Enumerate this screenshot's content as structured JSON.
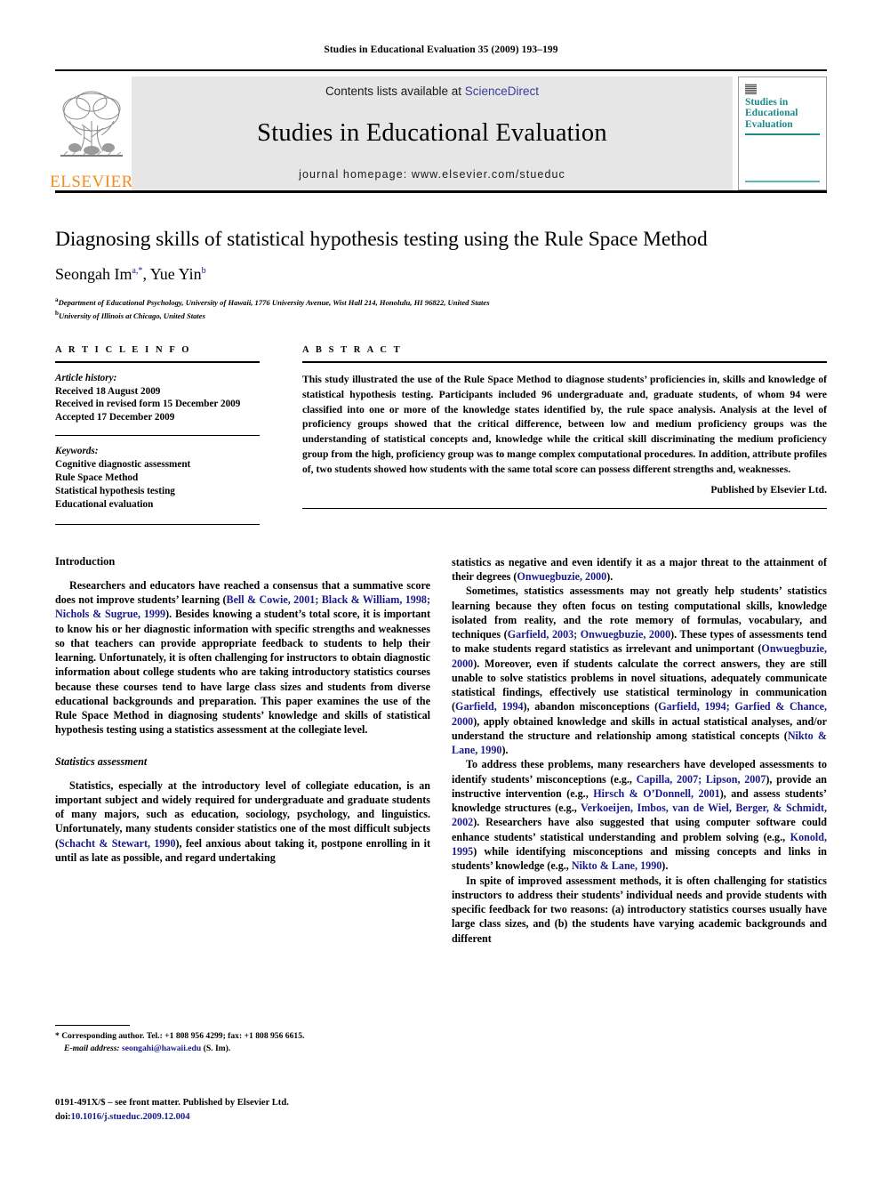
{
  "running_head": "Studies in Educational Evaluation 35 (2009) 193–199",
  "masthead": {
    "contents_prefix": "Contents lists available at ",
    "sciencedirect": "ScienceDirect",
    "journal_title": "Studies in Educational Evaluation",
    "homepage": "journal homepage: www.elsevier.com/stueduc",
    "publisher_wordmark": "ELSEVIER",
    "cover_title": "Studies in Educational Evaluation",
    "colors": {
      "link": "#3b3b9e",
      "cover_teal": "#1d8a8a",
      "elsevier_orange": "#F28C1E",
      "panel_gray": "#e6e6e6"
    }
  },
  "article": {
    "title": "Diagnosing skills of statistical hypothesis testing using the Rule Space Method",
    "authors": [
      {
        "name": "Seongah Im",
        "marker": "a,*"
      },
      {
        "name": "Yue Yin",
        "marker": "b"
      }
    ],
    "affiliations": [
      {
        "marker": "a",
        "text": "Department of Educational Psychology, University of Hawaii, 1776 University Avenue, Wist Hall 214, Honolulu, HI 96822, United States"
      },
      {
        "marker": "b",
        "text": "University of Illinois at Chicago, United States"
      }
    ]
  },
  "info": {
    "heading": "A R T I C L E   I N F O",
    "history_label": "Article history:",
    "history": [
      "Received 18 August 2009",
      "Received in revised form 15 December 2009",
      "Accepted 17 December 2009"
    ],
    "keywords_label": "Keywords:",
    "keywords": [
      "Cognitive diagnostic assessment",
      "Rule Space Method",
      "Statistical hypothesis testing",
      "Educational evaluation"
    ]
  },
  "abstract": {
    "heading": "A B S T R A C T",
    "text": "This study illustrated the use of the Rule Space Method to diagnose students’ proficiencies in, skills and knowledge of statistical hypothesis testing. Participants included 96 undergraduate and, graduate students, of whom 94 were classified into one or more of the knowledge states identified by, the rule space analysis. Analysis at the level of proficiency groups showed that the critical difference, between low and medium proficiency groups was the understanding of statistical concepts and, knowledge while the critical skill discriminating the medium proficiency group from the high, proficiency group was to mange complex computational procedures. In addition, attribute profiles of, two students showed how students with the same total score can possess different strengths and, weaknesses.",
    "published_by": "Published by Elsevier Ltd."
  },
  "body": {
    "left": {
      "heading": "Introduction",
      "p1_a": "Researchers and educators have reached a consensus that a summative score does not improve students’ learning (",
      "p1_ref": "Bell & Cowie, 2001; Black & William, 1998; Nichols & Sugrue, 1999",
      "p1_b": "). Besides knowing a student’s total score, it is important to know his or her diagnostic information with specific strengths and weaknesses so that teachers can provide appropriate feedback to students to help their learning. Unfortunately, it is often challenging for instructors to obtain diagnostic information about college students who are taking introductory statistics courses because these courses tend to have large class sizes and students from diverse educational backgrounds and preparation. This paper examines the use of the Rule Space Method in diagnosing students’ knowledge and skills of statistical hypothesis testing using a statistics assessment at the collegiate level.",
      "subheading": "Statistics assessment",
      "p2_a": "Statistics, especially at the introductory level of collegiate education, is an important subject and widely required for undergraduate and graduate students of many majors, such as education, sociology, psychology, and linguistics. Unfortunately, many students consider statistics one of the most difficult subjects (",
      "p2_ref": "Schacht & Stewart, 1990",
      "p2_b": "), feel anxious about taking it, postpone enrolling in it until as late as possible, and regard undertaking"
    },
    "right": {
      "p1_a": "statistics as negative and even identify it as a major threat to the attainment of their degrees (",
      "p1_ref": "Onwuegbuzie, 2000",
      "p1_b": ").",
      "p2_a": "Sometimes, statistics assessments may not greatly help students’ statistics learning because they often focus on testing computational skills, knowledge isolated from reality, and the rote memory of formulas, vocabulary, and techniques (",
      "p2_ref1": "Garfield, 2003; Onwuegbuzie, 2000",
      "p2_b": "). These types of assessments tend to make students regard statistics as irrelevant and unimportant (",
      "p2_ref2": "Onwuegbuzie, 2000",
      "p2_c": "). Moreover, even if students calculate the correct answers, they are still unable to solve statistics problems in novel situations, adequately communicate statistical findings, effectively use statistical terminology in communication (",
      "p2_ref3": "Garfield, 1994",
      "p2_d": "), abandon misconceptions (",
      "p2_ref4": "Garfield, 1994; Garfied & Chance, 2000",
      "p2_e": "), apply obtained knowledge and skills in actual statistical analyses, and/or understand the structure and relationship among statistical concepts (",
      "p2_ref5": "Nikto & Lane, 1990",
      "p2_f": ").",
      "p3_a": "To address these problems, many researchers have developed assessments to identify students’ misconceptions (e.g., ",
      "p3_ref1": "Capilla, 2007; Lipson, 2007",
      "p3_b": "), provide an instructive intervention (e.g., ",
      "p3_ref2": "Hirsch & O’Donnell, 2001",
      "p3_c": "), and assess students’ knowledge structures (e.g., ",
      "p3_ref3": "Verkoeijen, Imbos, van de Wiel, Berger, & Schmidt, 2002",
      "p3_d": "). Researchers have also suggested that using computer software could enhance students’ statistical understanding and problem solving (e.g., ",
      "p3_ref4": "Konold, 1995",
      "p3_e": ") while identifying misconceptions and missing concepts and links in students’ knowledge (e.g., ",
      "p3_ref5": "Nikto & Lane, 1990",
      "p3_f": ").",
      "p4": "In spite of improved assessment methods, it is often challenging for statistics instructors to address their students’ individual needs and provide students with specific feedback for two reasons: (a) introductory statistics courses usually have large class sizes, and (b) the students have varying academic backgrounds and different"
    }
  },
  "footnote": {
    "marker": "*",
    "corresponding": "Corresponding author. Tel.: +1 808 956 4299; fax: +1 808 956 6615.",
    "email_label": "E-mail address:",
    "email": "seongahi@hawaii.edu",
    "email_suffix": "(S. Im)."
  },
  "footer": {
    "front_matter": "0191-491X/$ – see front matter. Published by Elsevier Ltd.",
    "doi_label": "doi:",
    "doi": "10.1016/j.stueduc.2009.12.004"
  }
}
